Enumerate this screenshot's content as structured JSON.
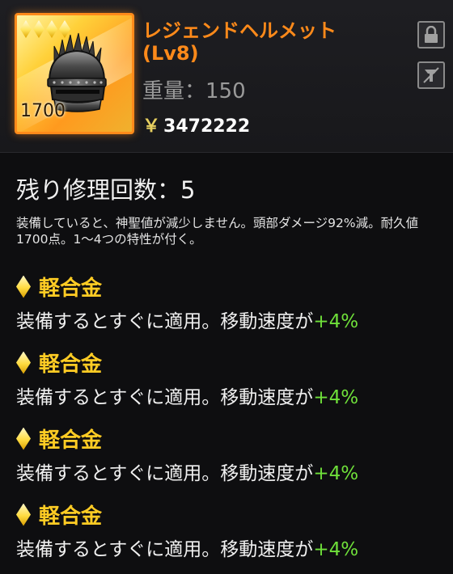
{
  "item": {
    "name_line1": "レジェンドヘルメット",
    "name_line2": "(Lv8)",
    "weight_label": "重量：",
    "weight_value": "150",
    "price_symbol": "￥",
    "price_value": "3472222",
    "durability": "1700",
    "rarity_count": 4,
    "icon": "helmet-icon"
  },
  "buttons": {
    "lock_icon": "lock-icon",
    "unequip_icon": "unequip-icon"
  },
  "repair": {
    "text": "残り修理回数：5"
  },
  "description": "装備していると、神聖値が減少しません。頭部ダメージ92%減。耐久値1700点。1～4つの特性が付く。",
  "traits": [
    {
      "name": "軽合金",
      "desc_prefix": "装備するとすぐに適用。移動速度が",
      "bonus": "+4%"
    },
    {
      "name": "軽合金",
      "desc_prefix": "装備するとすぐに適用。移動速度が",
      "bonus": "+4%"
    },
    {
      "name": "軽合金",
      "desc_prefix": "装備するとすぐに適用。移動速度が",
      "bonus": "+4%"
    },
    {
      "name": "軽合金",
      "desc_prefix": "装備するとすぐに適用。移動速度が",
      "bonus": "+4%"
    }
  ],
  "colors": {
    "item_name": "#ff8a1a",
    "trait_name": "#ffcc24",
    "bonus": "#6fe03a",
    "background": "#0e0e10"
  }
}
